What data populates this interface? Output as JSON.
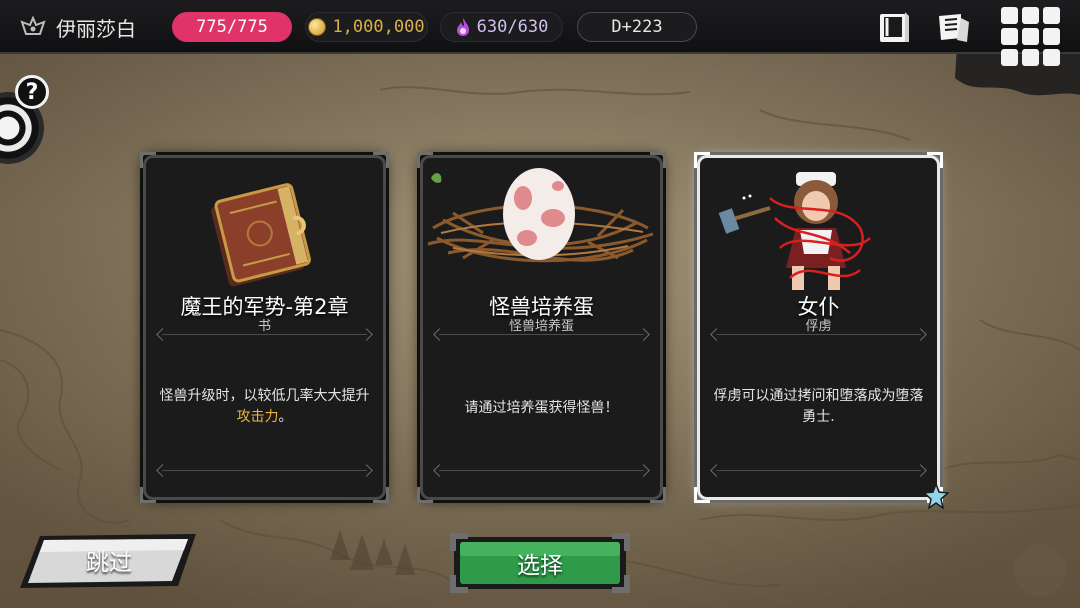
{
  "player": {
    "name": "伊丽莎白",
    "icon": "crown-emblem-icon"
  },
  "stats": {
    "hp": "775/775",
    "gold": "1,000,000",
    "mana": "630/630",
    "day": "D+223"
  },
  "top_icons": [
    "book-icon",
    "scroll-icon",
    "grid-menu-icon"
  ],
  "side": {
    "help_label": "?"
  },
  "cards": [
    {
      "title": "魔王的军势-第2章",
      "subtitle": "书",
      "desc_before": "怪兽升级时，以较低几率大大提升",
      "desc_highlight": "攻击力",
      "desc_after": "。",
      "art": "book-icon",
      "selected": false
    },
    {
      "title": "怪兽培养蛋",
      "subtitle": "怪兽培养蛋",
      "desc_before": "请通过培养蛋获得怪兽！",
      "desc_highlight": "",
      "desc_after": "",
      "art": "egg-nest-icon",
      "selected": false
    },
    {
      "title": "女仆",
      "subtitle": "俘虏",
      "desc_before": "俘虏可以通过拷问和堕落成为堕落勇士.",
      "desc_highlight": "",
      "desc_after": "",
      "art": "maid-captive-icon",
      "selected": true
    }
  ],
  "buttons": {
    "skip": "跳过",
    "choose": "选择"
  },
  "colors": {
    "hp_pill": "#e0336a",
    "highlight": "#f0b43a",
    "choose_button": "#2f9a4a",
    "skip_button": "#d8d8d8",
    "gold_text": "#d8b04a"
  }
}
